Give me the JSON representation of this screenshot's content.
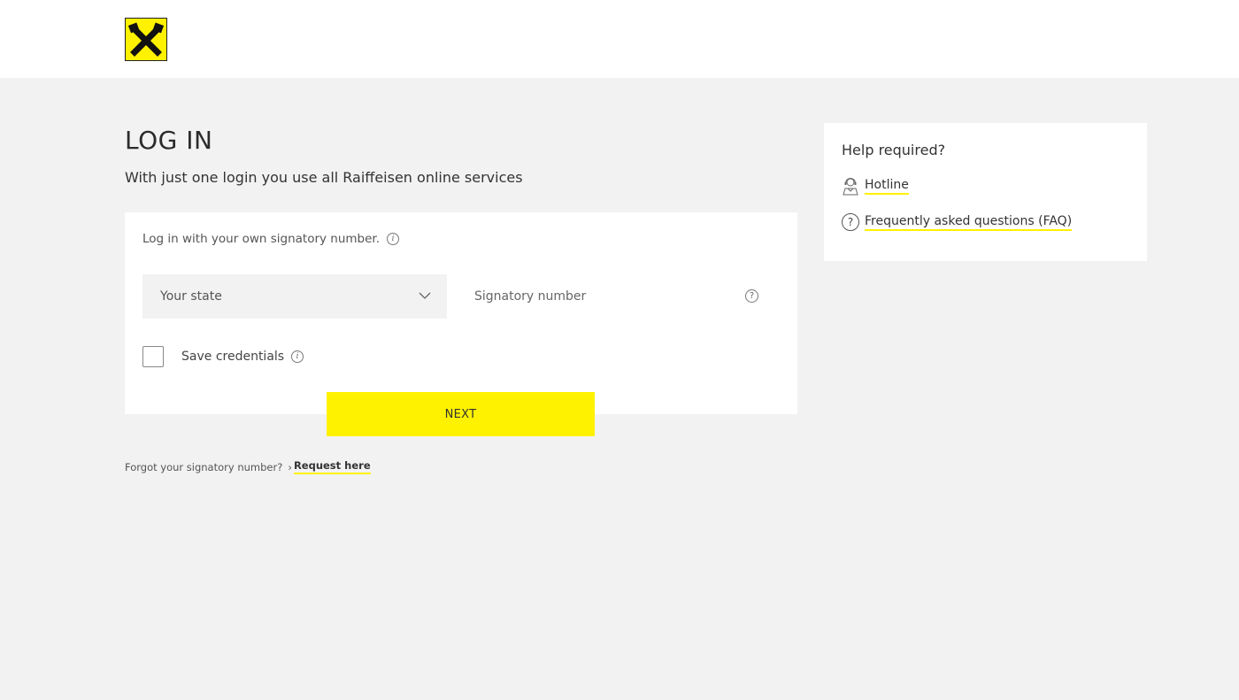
{
  "brand": {
    "accent_color": "#fff200",
    "logo_icon": "raiffeisen-gable-cross-icon"
  },
  "page": {
    "title": "LOG IN",
    "subtitle": "With just one login you use all Raiffeisen online services"
  },
  "login": {
    "hint": "Log in with your own signatory number.",
    "state_select": {
      "value": "Your state",
      "icon": "chevron-down-icon"
    },
    "signatory_field": {
      "placeholder": "Signatory number",
      "help_icon": "question-icon",
      "help_glyph": "?"
    },
    "save_credentials_label": "Save credentials",
    "save_credentials_checked": false,
    "next_button_label": "NEXT",
    "info_glyph": "i"
  },
  "forgot": {
    "text": "Forgot your signatory number?",
    "arrow": "›",
    "link_label": "Request here"
  },
  "help": {
    "title": "Help required?",
    "items": [
      {
        "label": "Hotline",
        "icon": "headset-person-icon"
      },
      {
        "label": "Frequently asked questions (FAQ)",
        "icon": "question-circle-icon",
        "glyph": "?"
      }
    ]
  }
}
